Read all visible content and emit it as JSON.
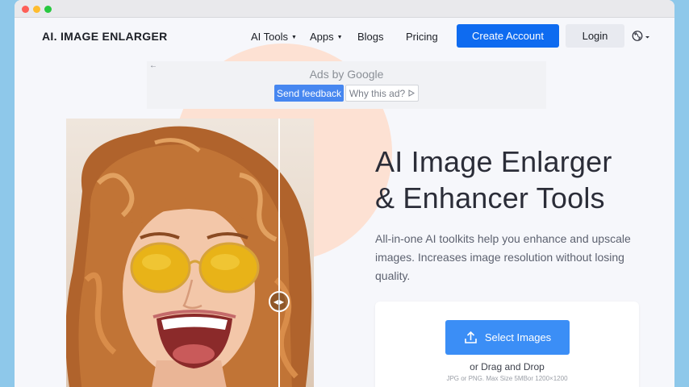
{
  "brand": {
    "logo": "AI. IMAGE ENLARGER"
  },
  "nav": {
    "ai_tools": "AI Tools",
    "apps": "Apps",
    "blogs": "Blogs",
    "pricing": "Pricing",
    "create_account": "Create Account",
    "login": "Login"
  },
  "ad": {
    "label": "Ads by Google",
    "send_feedback": "Send feedback",
    "why_this_ad": "Why this ad?"
  },
  "hero": {
    "title_line1": "AI Image Enlarger",
    "title_line2": "& Enhancer Tools",
    "description": "All-in-one AI toolkits help you enhance and upscale images. Increases image resolution without losing quality."
  },
  "upload": {
    "select_label": "Select Images",
    "drag_label": "or Drag and Drop",
    "max_size": "JPG or PNG. Max Size 5MBor 1200×1200"
  },
  "colors": {
    "primary": "#0e6bf0",
    "select_button": "#3b8ef6",
    "accent_circle": "#fde1d3",
    "window_bg": "#8ec8ea"
  },
  "icons": {
    "language": "language-icon",
    "upload": "upload-icon",
    "ad_back": "arrow-left-icon",
    "ad_choice": "play-outline-icon",
    "compare_handle": "left-right-arrows-icon"
  }
}
